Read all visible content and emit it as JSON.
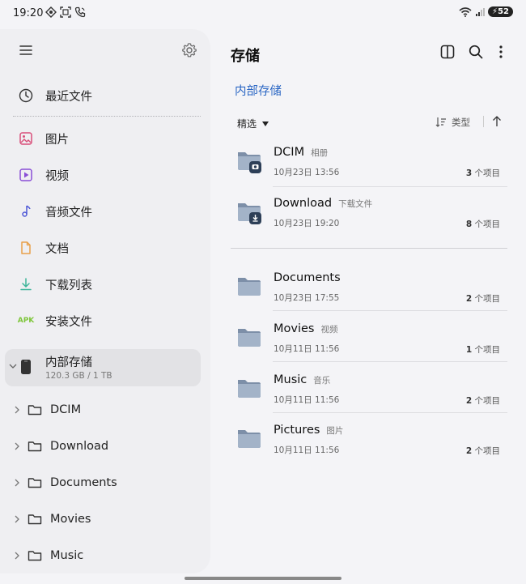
{
  "status_bar": {
    "time": "19:20",
    "battery": "52"
  },
  "sidebar": {
    "recent": "最近文件",
    "categories": [
      {
        "icon": "image-icon",
        "label": "图片",
        "color": "#d94f7a"
      },
      {
        "icon": "video-icon",
        "label": "视频",
        "color": "#8a4fd6"
      },
      {
        "icon": "music-note-icon",
        "label": "音频文件",
        "color": "#4e58d6"
      },
      {
        "icon": "document-icon",
        "label": "文档",
        "color": "#e8a04a"
      },
      {
        "icon": "download-icon",
        "label": "下载列表",
        "color": "#3fb59a"
      },
      {
        "icon": "apk-icon",
        "label": "安装文件",
        "apk_text": "APK",
        "color": "#7ec63a"
      }
    ],
    "storage": {
      "name": "内部存储",
      "size": "120.3 GB / 1 TB"
    },
    "tree": [
      "DCIM",
      "Download",
      "Documents",
      "Movies",
      "Music"
    ]
  },
  "main": {
    "title": "存储",
    "breadcrumb": "内部存储",
    "filter_label": "精选",
    "sort_label": "类型",
    "accent": "#2b67c4",
    "folders_top": [
      {
        "name": "DCIM",
        "alias": "相册",
        "date": "10月23日 13:56",
        "count": "3",
        "unit": "个项目",
        "badge": "camera"
      },
      {
        "name": "Download",
        "alias": "下载文件",
        "date": "10月23日 19:20",
        "count": "8",
        "unit": "个项目",
        "badge": "download"
      }
    ],
    "folders": [
      {
        "name": "Documents",
        "alias": "",
        "date": "10月23日 17:55",
        "count": "2",
        "unit": "个项目"
      },
      {
        "name": "Movies",
        "alias": "视频",
        "date": "10月11日 11:56",
        "count": "1",
        "unit": "个项目"
      },
      {
        "name": "Music",
        "alias": "音乐",
        "date": "10月11日 11:56",
        "count": "2",
        "unit": "个项目"
      },
      {
        "name": "Pictures",
        "alias": "图片",
        "date": "10月11日 11:56",
        "count": "2",
        "unit": "个项目"
      }
    ]
  }
}
